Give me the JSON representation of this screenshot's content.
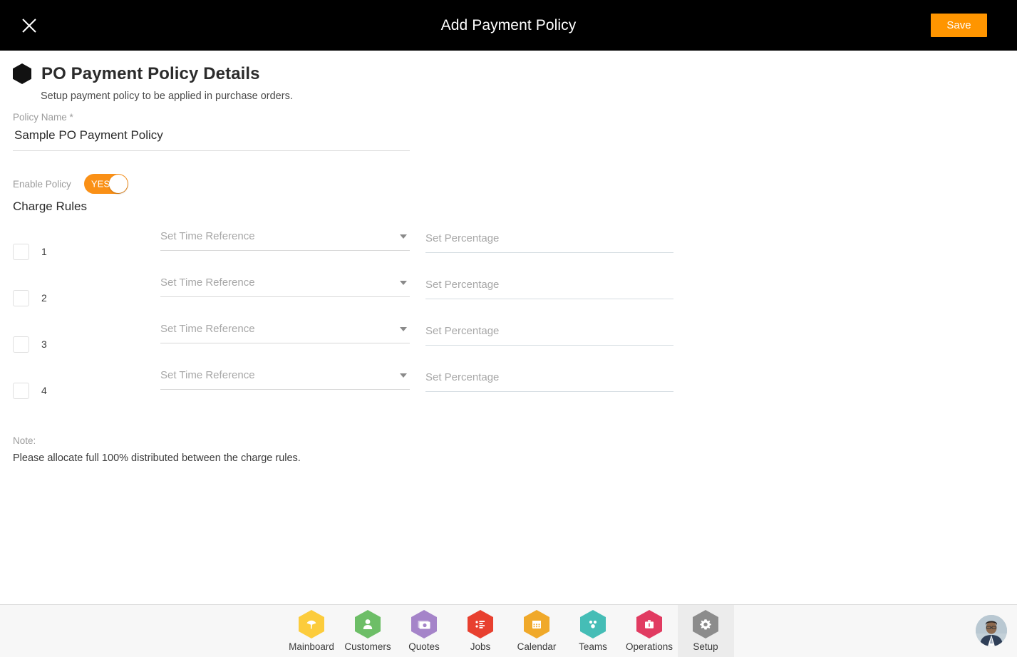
{
  "header": {
    "title": "Add Payment Policy",
    "close_icon": "close-icon",
    "save_label": "Save",
    "accent_color": "#FF9500",
    "background_color": "#000000"
  },
  "section": {
    "icon": "hexagon-icon",
    "title": "PO Payment Policy Details",
    "subtitle": "Setup payment policy to be applied in purchase orders."
  },
  "form": {
    "policy_name": {
      "label": "Policy Name *",
      "value": "Sample PO Payment Policy",
      "placeholder": "Policy Name"
    },
    "enable_policy": {
      "label": "Enable Policy",
      "toggle_value": "YES",
      "toggle_on": true,
      "toggle_color": "#FA9016"
    },
    "charge_rules_title": "Charge Rules",
    "rule_columns": {
      "time_reference_placeholder": "Set Time Reference",
      "percentage_placeholder": "Set Percentage"
    },
    "rules": [
      {
        "number": "1",
        "checked": false,
        "time_reference": "",
        "percentage": ""
      },
      {
        "number": "2",
        "checked": false,
        "time_reference": "",
        "percentage": ""
      },
      {
        "number": "3",
        "checked": false,
        "time_reference": "",
        "percentage": ""
      },
      {
        "number": "4",
        "checked": false,
        "time_reference": "",
        "percentage": ""
      }
    ],
    "note": {
      "label": "Note:",
      "text": "Please allocate full 100% distributed between the charge rules."
    }
  },
  "navbar": {
    "items": [
      {
        "label": "Mainboard",
        "icon": "dashboard-icon",
        "color": "#FCCC3C",
        "active": false
      },
      {
        "label": "Customers",
        "icon": "person-icon",
        "color": "#6DBE67",
        "active": false
      },
      {
        "label": "Quotes",
        "icon": "money-icon",
        "color": "#A584C9",
        "active": false
      },
      {
        "label": "Jobs",
        "icon": "list-icon",
        "color": "#E8402F",
        "active": false
      },
      {
        "label": "Calendar",
        "icon": "calendar-icon",
        "color": "#F0A92A",
        "active": false
      },
      {
        "label": "Teams",
        "icon": "teams-icon",
        "color": "#45BDB6",
        "active": false
      },
      {
        "label": "Operations",
        "icon": "briefcase-icon",
        "color": "#E13B61",
        "active": false
      },
      {
        "label": "Setup",
        "icon": "gear-icon",
        "color": "#8C8C8C",
        "active": true
      }
    ],
    "avatar": "user-avatar"
  }
}
